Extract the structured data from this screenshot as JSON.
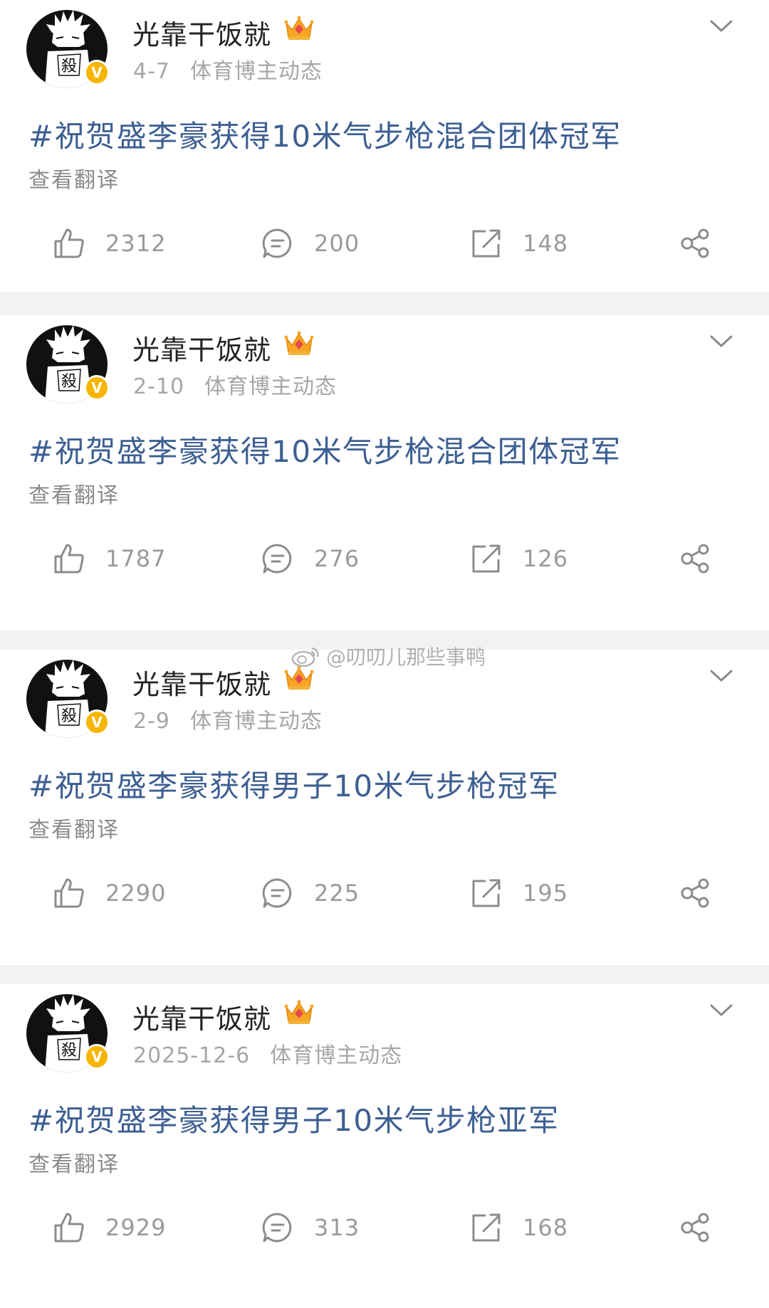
{
  "feed": {
    "posts": [
      {
        "username": "光靠干饭就",
        "date": "4-7",
        "source": "体育博主动态",
        "text": "#祝贺盛李豪获得10米气步枪混合团体冠军",
        "translate": "查看翻译",
        "likes": "2312",
        "comments": "200",
        "reposts": "148"
      },
      {
        "username": "光靠干饭就",
        "date": "2-10",
        "source": "体育博主动态",
        "text": "#祝贺盛李豪获得10米气步枪混合团体冠军",
        "translate": "查看翻译",
        "likes": "1787",
        "comments": "276",
        "reposts": "126"
      },
      {
        "username": "光靠干饭就",
        "date": "2-9",
        "source": "体育博主动态",
        "text": "#祝贺盛李豪获得男子10米气步枪冠军",
        "translate": "查看翻译",
        "likes": "2290",
        "comments": "225",
        "reposts": "195"
      },
      {
        "username": "光靠干饭就",
        "date": "2025-12-6",
        "source": "体育博主动态",
        "text": "#祝贺盛李豪获得男子10米气步枪亚军",
        "translate": "查看翻译",
        "likes": "2929",
        "comments": "313",
        "reposts": "168"
      }
    ]
  },
  "avatar_glyph": "殺",
  "verified_badge": "V",
  "watermark": "@叨叨儿那些事鸭",
  "colors": {
    "link_blue": "#3d5f92",
    "meta_gray": "#a6a6a6",
    "badge_gold": "#f7b500",
    "background": "#f2f2f2"
  },
  "icons": [
    "avatar-image",
    "verified-icon",
    "crown-icon",
    "chevron-down-icon",
    "like-icon",
    "comment-icon",
    "repost-icon",
    "share-icon",
    "weibo-logo-icon"
  ]
}
